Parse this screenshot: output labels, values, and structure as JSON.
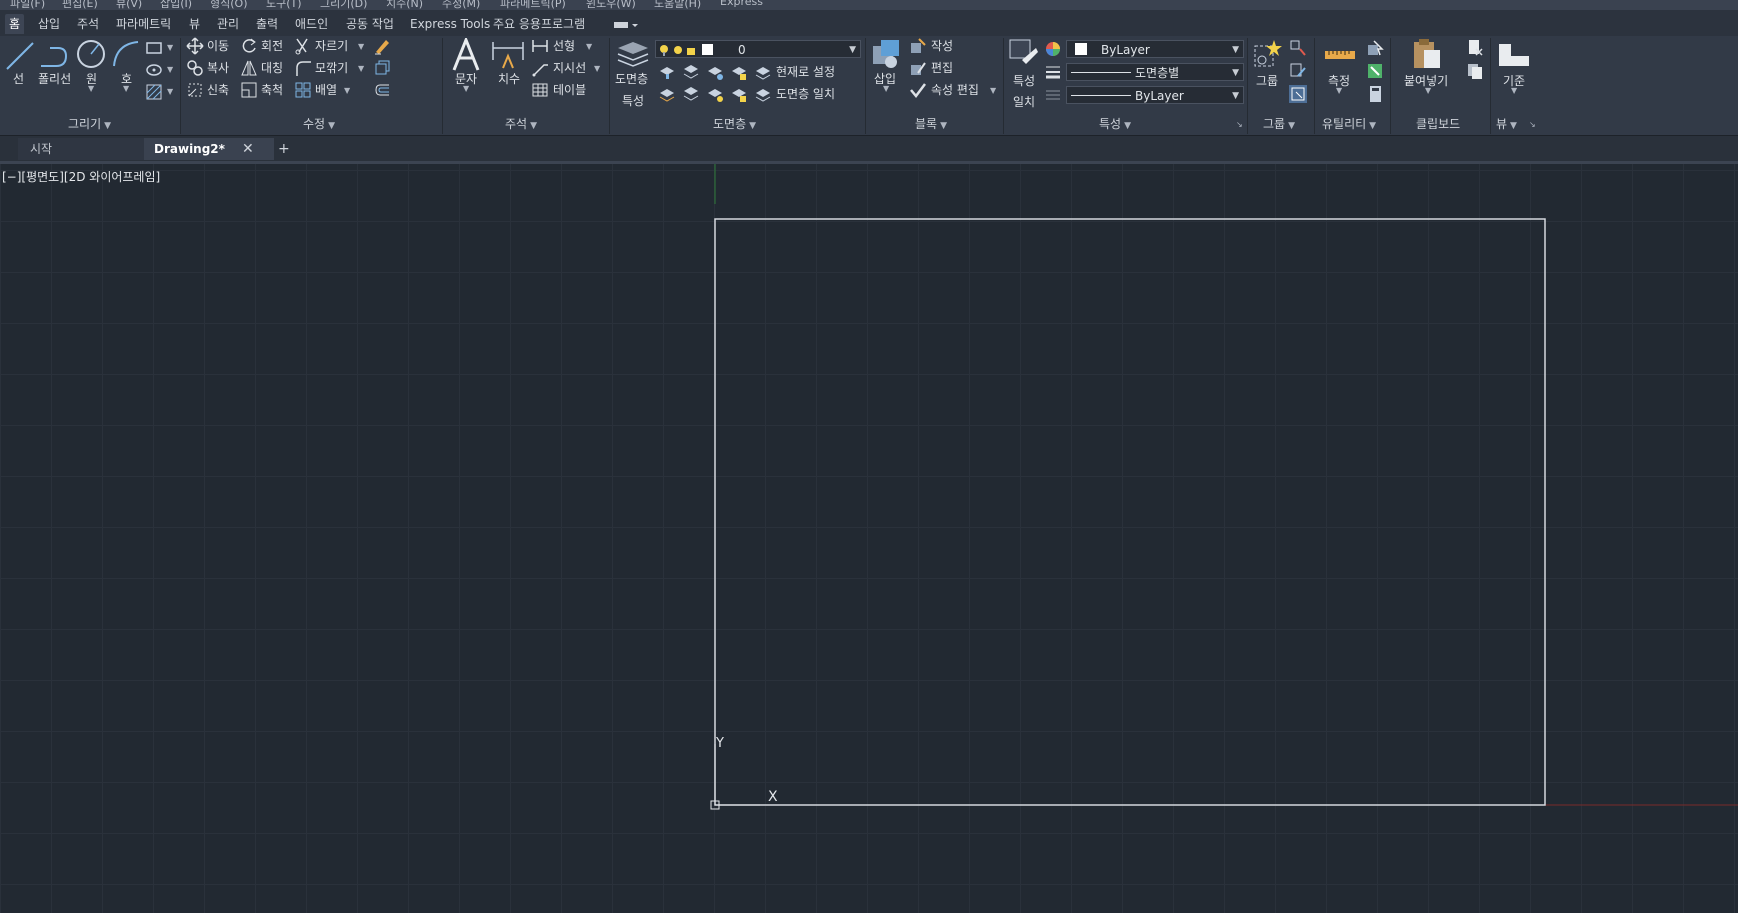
{
  "menubar": [
    "파일(F)",
    "편집(E)",
    "뷰(V)",
    "삽입(I)",
    "형식(O)",
    "도구(T)",
    "그리기(D)",
    "치수(N)",
    "수정(M)",
    "파라메트릭(P)",
    "윈도우(W)",
    "도움말(H)",
    "Express"
  ],
  "ribbon_tabs": [
    "홈",
    "삽입",
    "주석",
    "파라메트릭",
    "뷰",
    "관리",
    "출력",
    "애드인",
    "공동 작업",
    "Express Tools",
    "주요 응용프로그램"
  ],
  "draw": {
    "line": "선",
    "polyline": "폴리선",
    "circle": "원",
    "arc": "호",
    "title": "그리기"
  },
  "modify": {
    "move": "이동",
    "rotate": "회전",
    "trim": "자르기",
    "copy": "복사",
    "mirror": "대칭",
    "fillet": "모깎기",
    "stretch": "신축",
    "scale": "축척",
    "array": "배열",
    "title": "수정"
  },
  "annotation": {
    "text": "문자",
    "dimension": "치수",
    "linear": "선형",
    "leader": "지시선",
    "table": "테이블",
    "title": "주석"
  },
  "layers": {
    "layer_props": "도면층",
    "layer_props2": "특성",
    "current_layer": "0",
    "make_current": "현재로 설정",
    "match_layer": "도면층 일치",
    "title": "도면층"
  },
  "block": {
    "insert": "삽입",
    "create": "작성",
    "edit": "편집",
    "edit_attr": "속성 편집",
    "title": "블록"
  },
  "properties": {
    "match": "특성",
    "match2": "일치",
    "color": "ByLayer",
    "lineweight": "도면층별",
    "linetype": "ByLayer",
    "title": "특성"
  },
  "groups": {
    "group": "그룹",
    "title": "그룹"
  },
  "utilities": {
    "measure": "측정",
    "title": "유틸리티"
  },
  "clipboard": {
    "paste": "붙여넣기",
    "title": "클립보드"
  },
  "view": {
    "base": "기준",
    "title": "뷰"
  },
  "doc_tabs": {
    "start": "시작",
    "drawing": "Drawing2*",
    "add": "+"
  },
  "viewport_label": "[−][평면도][2D 와이어프레임]",
  "ucs": {
    "x": "X",
    "y": "Y"
  },
  "colors": {
    "accent": "#3d4554",
    "canvas": "#222932",
    "ribbon": "#323a47"
  }
}
